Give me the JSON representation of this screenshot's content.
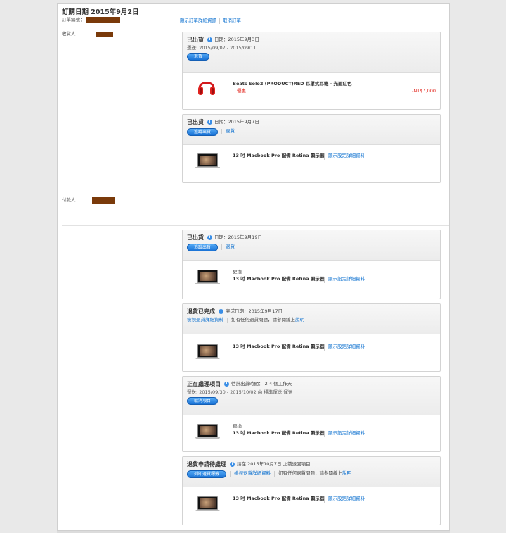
{
  "header": {
    "title": "訂購日期 2015年9月2日",
    "order_no_label": "訂單編號：",
    "show_details": "顯示訂單詳細資訊",
    "cancel_order": "取消訂單"
  },
  "recipient_label": "收貨人",
  "payer_label": "付款人",
  "cards": [
    {
      "status": "已出貨",
      "meta": "日期：2015年9月3日",
      "sub": "運送: 2015/09/07 - 2015/09/11",
      "button": "退貨",
      "item": {
        "name": "Beats Solo2 (PRODUCT)RED 耳罩式耳機 - 光面紅色",
        "tag": "優惠",
        "price": "-NT$7,000"
      }
    },
    {
      "status": "已出貨",
      "meta": "日期：2015年9月7日",
      "button": "追蹤出貨",
      "link": "退貨",
      "item": {
        "name": "13 吋 Macbook Pro 配備 Retina 顯示器",
        "details_link": "顯示設定詳細資料"
      }
    },
    {
      "status": "已出貨",
      "meta": "日期：2015年9月19日",
      "button": "追蹤出貨",
      "link": "退貨",
      "item": {
        "pre": "更換",
        "name": "13 吋 Macbook Pro 配備 Retina 顯示器",
        "details_link": "顯示設定詳細資料"
      }
    },
    {
      "status": "退貨已完成",
      "meta": "完成日期：2015年9月17日",
      "link": "檢視退貨詳細資料",
      "note_pre": "如有任何退貨問題，請參閱線上",
      "note_link": "說明",
      "item": {
        "name": "13 吋 Macbook Pro 配備 Retina 顯示器",
        "details_link": "顯示設定詳細資料"
      }
    },
    {
      "status": "正在處理項目",
      "meta": "估計出貨時間： 2-4 個工作天",
      "sub": "運送: 2015/09/30 - 2015/10/02 由 標準運送 運送",
      "button": "取消項目",
      "item": {
        "pre": "更換",
        "name": "13 吋 Macbook Pro 配備 Retina 顯示器",
        "details_link": "顯示設定詳細資料"
      }
    },
    {
      "status": "退貨申請待處理",
      "meta": "請在 2015年10月7日 之前退回項目",
      "button": "列印退貨標籤",
      "link": "檢視退貨詳細資料",
      "note_pre": "如有任何退貨問題，請參閱線上",
      "note_link": "說明",
      "item": {
        "name": "13 吋 Macbook Pro 配備 Retina 顯示器",
        "details_link": "顯示設定詳細資料"
      }
    }
  ]
}
